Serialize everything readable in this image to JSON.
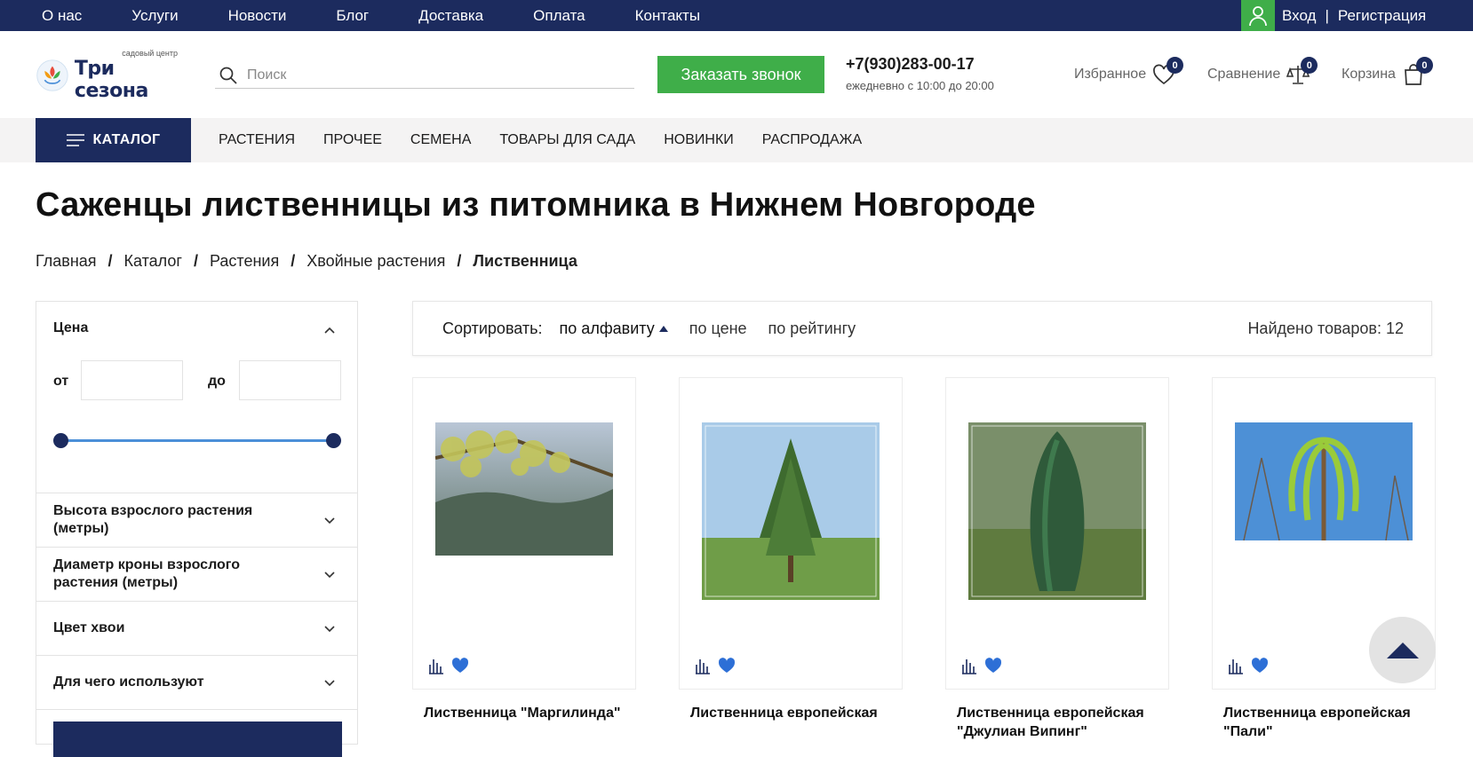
{
  "topnav": [
    "О нас",
    "Услуги",
    "Новости",
    "Блог",
    "Доставка",
    "Оплата",
    "Контакты"
  ],
  "auth": {
    "login": "Вход",
    "sep": "|",
    "register": "Регистрация"
  },
  "logo": {
    "small": "садовый центр",
    "big": "Три сезона"
  },
  "search": {
    "placeholder": "Поиск"
  },
  "callback": "Заказать звонок",
  "phone": "+7(930)283-00-17",
  "hours": "ежедневно с 10:00 до 20:00",
  "header_links": {
    "favorites": {
      "label": "Избранное",
      "count": "0"
    },
    "compare": {
      "label": "Сравнение",
      "count": "0"
    },
    "cart": {
      "label": "Корзина",
      "count": "0"
    }
  },
  "catalog_button": "КАТАЛОГ",
  "catnav": [
    "РАСТЕНИЯ",
    "ПРОЧЕЕ",
    "СЕМЕНА",
    "ТОВАРЫ ДЛЯ САДА",
    "НОВИНКИ",
    "РАСПРОДАЖА"
  ],
  "page_title": "Саженцы лиственницы из питомника в Нижнем Новгороде",
  "breadcrumbs": [
    "Главная",
    "Каталог",
    "Растения",
    "Хвойные растения",
    "Лиственница"
  ],
  "filters": {
    "price": {
      "title": "Цена",
      "from": "от",
      "to": "до"
    },
    "rows": [
      "Высота взрослого растения (метры)",
      "Диаметр кроны взрослого растения (метры)",
      "Цвет хвои",
      "Для чего используют"
    ]
  },
  "sort": {
    "label": "Сортировать:",
    "options": [
      "по алфавиту",
      "по цене",
      "по рейтингу"
    ],
    "found": "Найдено товаров: 12"
  },
  "products": [
    {
      "name": "Лиственница \"Маргилинда\""
    },
    {
      "name": "Лиственница европейская"
    },
    {
      "name": "Лиственница европейская \"Джулиан Випинг\""
    },
    {
      "name": "Лиственница европейская \"Пали\""
    }
  ],
  "colors": {
    "navy": "#1c2b5e",
    "green": "#3fae49",
    "accent_blue": "#4b8fd8"
  }
}
